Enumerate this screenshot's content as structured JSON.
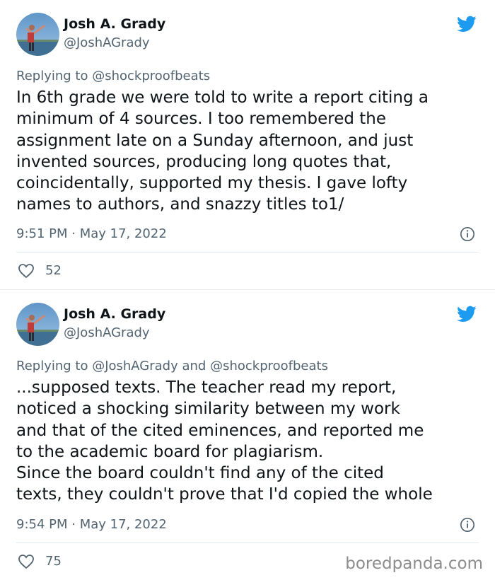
{
  "colors": {
    "twitter_blue": "#1d9bf0",
    "secondary_text": "#536471",
    "primary_text": "#0f1419"
  },
  "tweets": [
    {
      "author_name": "Josh A. Grady",
      "author_handle": "@JoshAGrady",
      "replying_to": "Replying to @shockproofbeats",
      "body_lines": [
        "In 6th grade we were told to write a report citing a",
        "minimum of 4 sources. I too remembered the",
        "assignment late on a Sunday afternoon, and just",
        "invented sources, producing long quotes that,",
        "coincidentally, supported my thesis. I gave lofty",
        "names to authors, and snazzy titles to1/"
      ],
      "timestamp": "9:51 PM · May 17, 2022",
      "likes": "52",
      "icons": {
        "avatar": "avatar-photo",
        "brand": "twitter-bird-icon",
        "info": "info-icon",
        "like": "heart-icon"
      }
    },
    {
      "author_name": "Josh A. Grady",
      "author_handle": "@JoshAGrady",
      "replying_to": "Replying to @JoshAGrady and @shockproofbeats",
      "body_lines": [
        "...supposed texts. The teacher read my report,",
        "noticed a shocking similarity between my work",
        "and that of the cited eminences, and reported me",
        "to the academic board for plagiarism.",
        "Since the board couldn't find any of the cited",
        "texts, they couldn't prove that I'd copied the whole"
      ],
      "timestamp": "9:54 PM · May 17, 2022",
      "likes": "75",
      "icons": {
        "avatar": "avatar-photo",
        "brand": "twitter-bird-icon",
        "info": "info-icon",
        "like": "heart-icon"
      }
    }
  ],
  "watermark": "boredpanda.com"
}
